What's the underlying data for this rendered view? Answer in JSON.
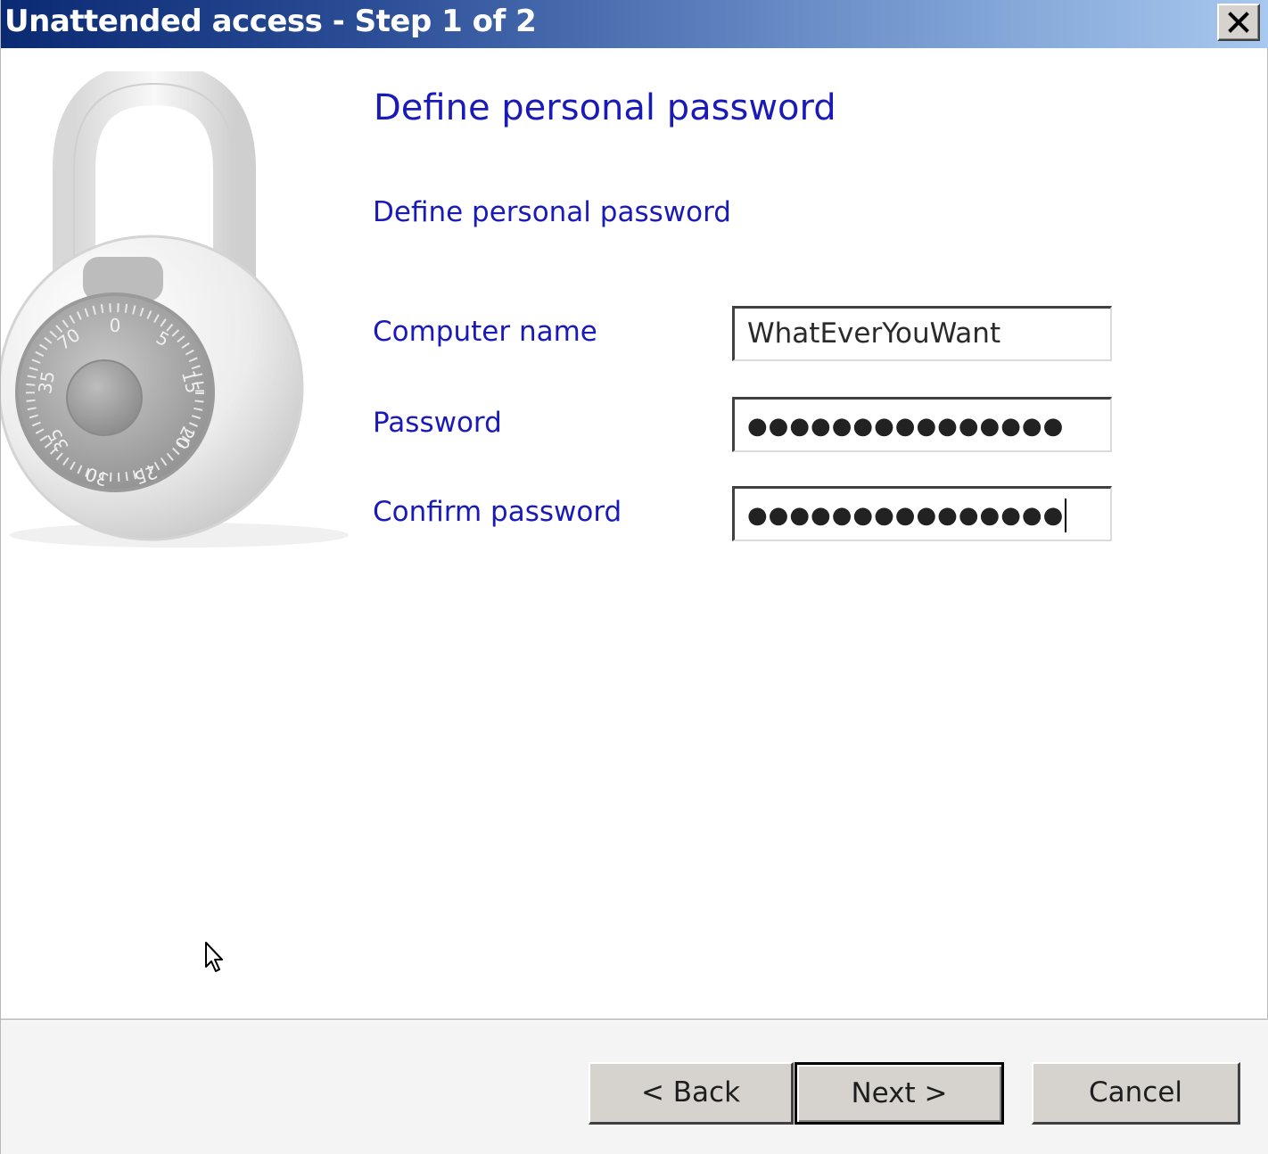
{
  "window": {
    "title": "Unattended access - Step 1 of 2",
    "close_label": "Close"
  },
  "content": {
    "heading": "Define personal password",
    "subheading": "Define personal password",
    "fields": {
      "computer_name": {
        "label": "Computer name",
        "value": "WhatEverYouWant"
      },
      "password": {
        "label": "Password",
        "masked": "●●●●●●●●●●●●●●●"
      },
      "confirm_password": {
        "label": "Confirm password",
        "masked": "●●●●●●●●●●●●●●●"
      }
    }
  },
  "buttons": {
    "back": "< Back",
    "next": "Next >",
    "cancel": "Cancel"
  },
  "icons": {
    "lock": "combination-padlock-icon",
    "close": "close-x-icon",
    "cursor": "mouse-pointer-icon"
  },
  "colors": {
    "label_blue": "#1a1ab8",
    "titlebar_start": "#0a2a73",
    "titlebar_end": "#a8c8ee",
    "button_face": "#d6d3ce"
  }
}
